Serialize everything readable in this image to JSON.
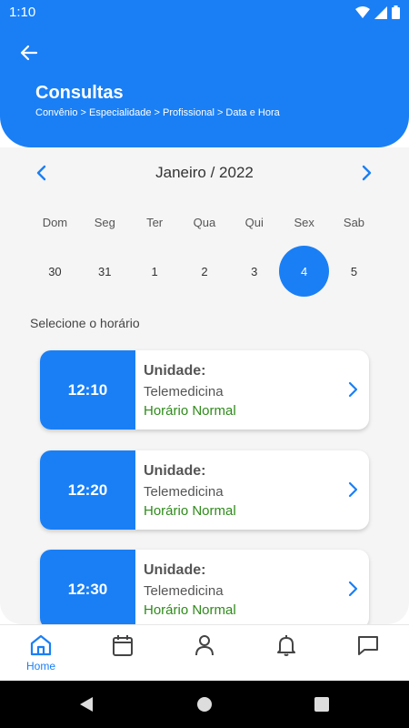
{
  "status_bar": {
    "time": "1:10"
  },
  "header": {
    "title": "Consultas",
    "breadcrumb": "Convênio > Especialidade > Profissional > Data e Hora"
  },
  "calendar": {
    "month_label": "Janeiro / 2022",
    "weekdays": [
      "Dom",
      "Seg",
      "Ter",
      "Qua",
      "Qui",
      "Sex",
      "Sab"
    ],
    "days": [
      "30",
      "31",
      "1",
      "2",
      "3",
      "4",
      "5"
    ],
    "selected_day": "4"
  },
  "slots_section": {
    "label": "Selecione o horário",
    "slots": [
      {
        "time": "12:10",
        "unit_label": "Unidade:",
        "place": "Telemedicina",
        "type": "Horário Normal"
      },
      {
        "time": "12:20",
        "unit_label": "Unidade:",
        "place": "Telemedicina",
        "type": "Horário Normal"
      },
      {
        "time": "12:30",
        "unit_label": "Unidade:",
        "place": "Telemedicina",
        "type": "Horário Normal"
      }
    ]
  },
  "bottom_nav": {
    "home_label": "Home",
    "items": [
      "home-icon",
      "calendar-icon",
      "person-icon",
      "bell-icon",
      "chat-icon"
    ]
  },
  "colors": {
    "primary": "#1a7ff5",
    "success_text": "#2e8b1a",
    "background": "#f5f5f5"
  }
}
